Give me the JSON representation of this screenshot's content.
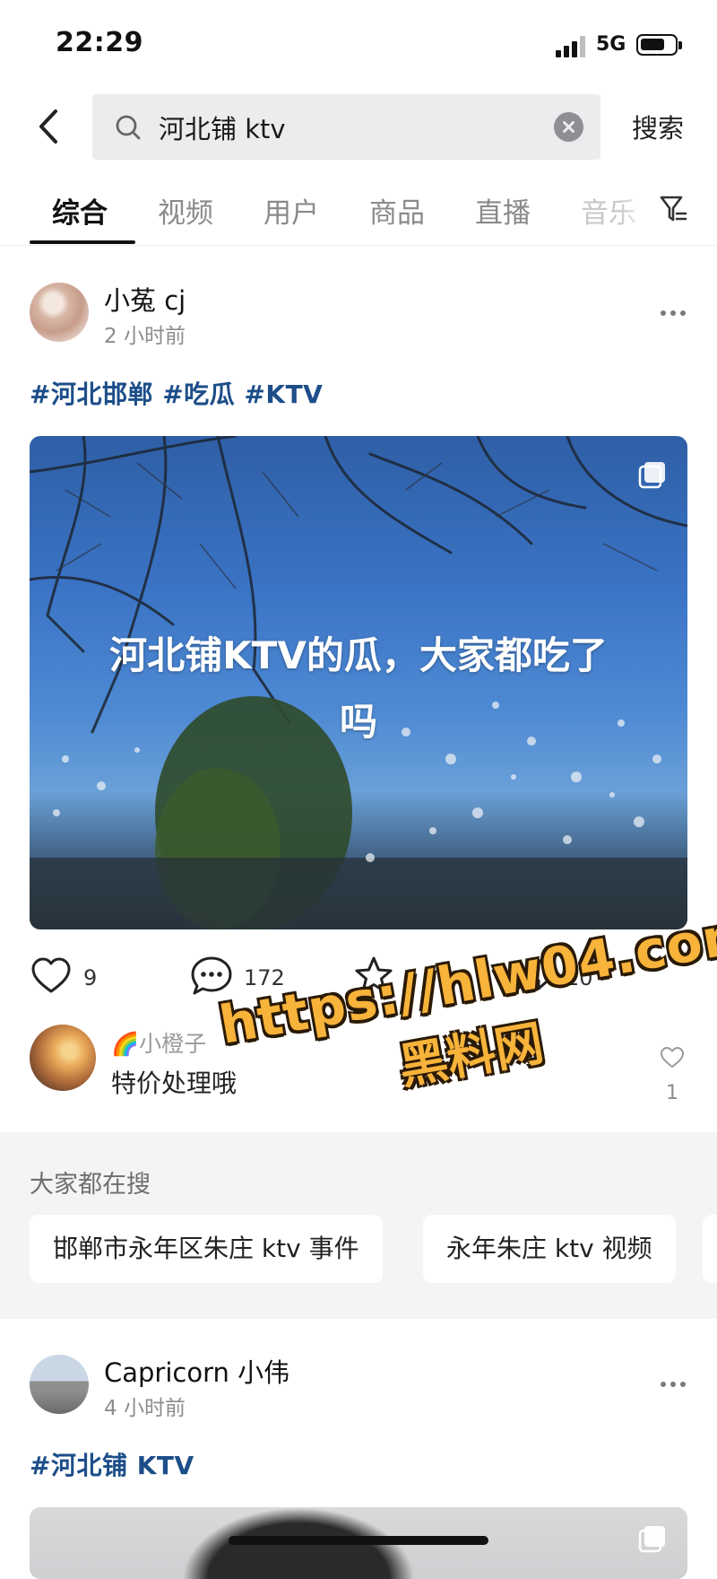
{
  "status_bar": {
    "time": "22:29",
    "network": "5G"
  },
  "search": {
    "query": "河北铺 ktv",
    "submit_label": "搜索"
  },
  "tabs": [
    {
      "label": "综合",
      "active": true
    },
    {
      "label": "视频"
    },
    {
      "label": "用户"
    },
    {
      "label": "商品"
    },
    {
      "label": "直播"
    },
    {
      "label": "音乐"
    }
  ],
  "post1": {
    "author": "小菟 cj",
    "time": "2 小时前",
    "tags": "#河北邯郸 #吃瓜 #KTV",
    "image_text_line1": "河北铺KTV的瓜，大家都吃了",
    "image_text_line2": "吗",
    "likes": "9",
    "comments": "172",
    "favorites": "1",
    "shares": "20"
  },
  "top_comment": {
    "user": "🌈小橙子",
    "text": "特价处理哦",
    "likes": "1"
  },
  "watermark": {
    "line1": "https://hlw04.com",
    "line2": "黑料网"
  },
  "trending": {
    "title": "大家都在搜",
    "items": [
      "邯郸市永年区朱庄 ktv 事件",
      "永年朱庄 ktv 视频"
    ]
  },
  "post2": {
    "author": "Capricorn 小伟",
    "time": "4 小时前",
    "tags": "#河北铺 KTV"
  },
  "colors": {
    "hashtag": "#1d4e89",
    "watermark": "#f7b33a"
  }
}
